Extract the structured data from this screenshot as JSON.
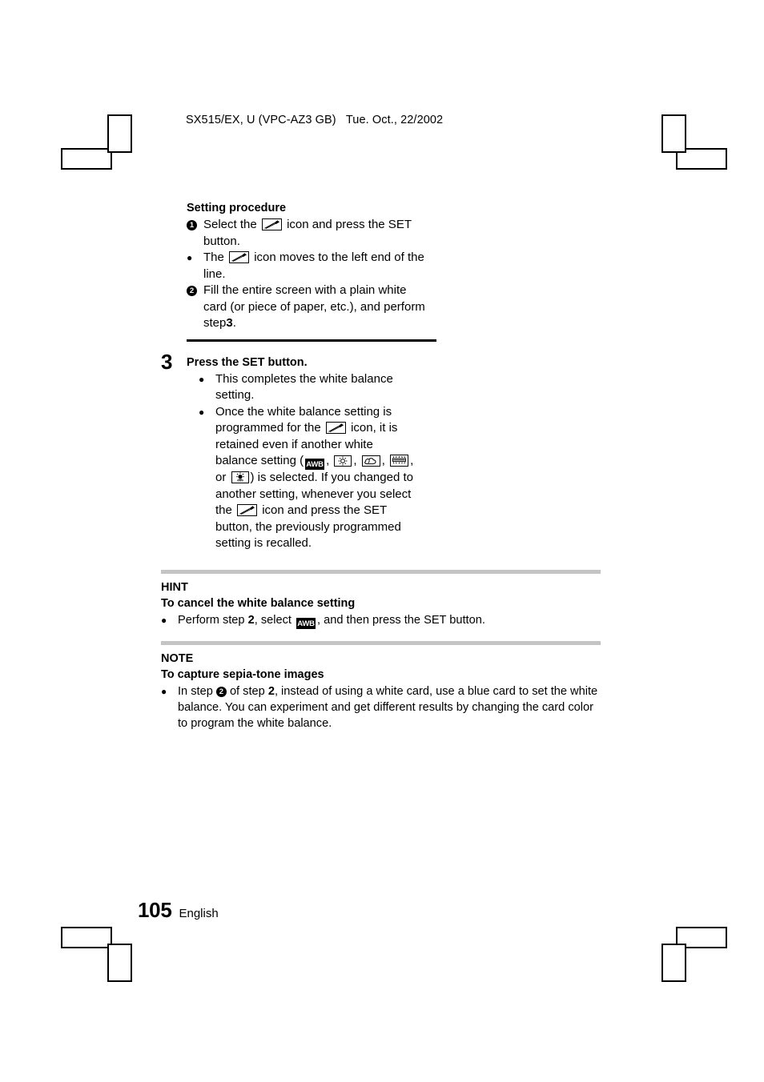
{
  "header": {
    "text": "SX515/EX, U (VPC-AZ3 GB)   Tue. Oct., 22/2002"
  },
  "procedure": {
    "heading": "Setting procedure",
    "items": [
      {
        "marker": "1",
        "marker_type": "filled-circle-number",
        "text_before": "Select the",
        "icon": "eyedropper-icon",
        "text_after": "icon and press the SET button."
      },
      {
        "marker": "●",
        "marker_type": "bullet",
        "text_before": "The",
        "icon": "eyedropper-icon",
        "text_after": "icon moves to the left end of the line."
      },
      {
        "marker": "2",
        "marker_type": "filled-circle-number",
        "text_before": "Fill the entire screen with a plain white card (or piece of paper, etc.), and perform step",
        "bold_ref": "3",
        "text_after": "."
      }
    ]
  },
  "step3": {
    "number": "3",
    "title": "Press the SET button.",
    "bullets": [
      {
        "marker": "●",
        "text": "This completes the white balance setting."
      },
      {
        "marker": "●",
        "part1": "Once the white balance setting is programmed for the",
        "icon1": "eyedropper-icon",
        "part2": "icon, it is retained even if another white balance setting (",
        "icons": [
          "awb-icon",
          "daylight-sun-icon",
          "cloudy-icon",
          "fluorescent-icon",
          "incandescent-icon"
        ],
        "icon_separators": [
          ",",
          ",",
          ",",
          ", or"
        ],
        "part3": ") is selected. If you changed to another setting, whenever you select the",
        "icon2": "eyedropper-icon",
        "part4": "icon and press the SET button, the previously programmed setting is recalled."
      }
    ]
  },
  "hint": {
    "label": "HINT",
    "subheading": "To cancel the white balance setting",
    "bullet_marker": "●",
    "text_before": "Perform step",
    "bold_ref": "2",
    "text_mid": ", select",
    "icon": "awb-icon",
    "text_after": ", and then press the SET button."
  },
  "note": {
    "label": "NOTE",
    "subheading": "To capture sepia-tone images",
    "bullet_marker": "●",
    "text_before": "In step",
    "inline_marker": "2",
    "text_mid": "of step",
    "bold_ref": "2",
    "text_after": ", instead of using a white card, use a blue card to set the white balance. You can experiment and get different results by changing the card color to program the white balance."
  },
  "footer": {
    "page_number": "105",
    "language": "English"
  },
  "icon_labels": {
    "awb": "AWB"
  },
  "colors": {
    "text": "#000000",
    "page_background": "#ffffff",
    "gray_rule": "#c4c4c4",
    "black_rule": "#000000"
  }
}
